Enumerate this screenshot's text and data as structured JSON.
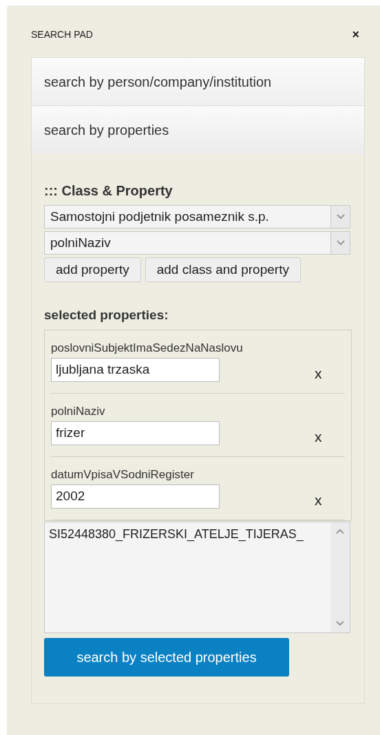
{
  "panel": {
    "title": "SEARCH PAD",
    "close": "×"
  },
  "sections": [
    {
      "label": "search by person/company/institution",
      "expanded": false
    },
    {
      "label": "search by properties",
      "expanded": true
    }
  ],
  "class_property": {
    "heading": "::: Class & Property",
    "class_select": "Samostojni podjetnik posameznik s.p.",
    "property_select": "polniNaziv",
    "buttons": [
      "add property",
      "add class and property"
    ]
  },
  "selected": {
    "heading": "selected properties:",
    "items": [
      {
        "label": "poslovniSubjektImaSedezNaNaslovu",
        "value": "ljubljana trzaska",
        "remove": "x"
      },
      {
        "label": "polniNaziv",
        "value": "frizer",
        "remove": "x"
      },
      {
        "label": "datumVpisaVSodniRegister",
        "value": "2002",
        "remove": "x"
      }
    ]
  },
  "results": [
    "SI52448380_FRIZERSKI_ATELJE_TIJERAS_"
  ],
  "search_button": "search by selected properties"
}
